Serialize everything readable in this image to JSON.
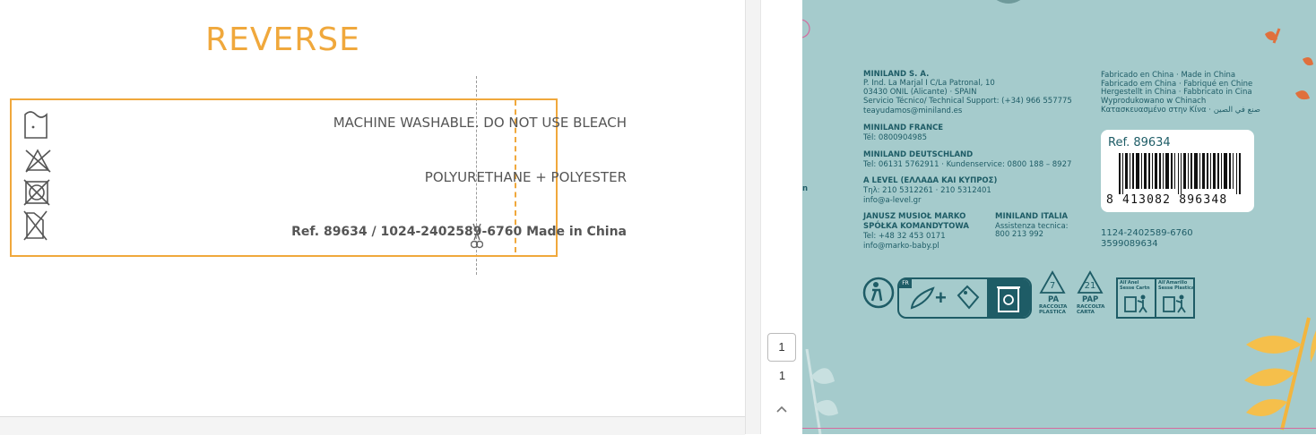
{
  "label": {
    "title": "REVERSE",
    "lines": [
      "MACHINE WASHABLE. DO NOT USE BLEACH",
      "POLYURETHANE + POLYESTER",
      "Ref. 89634 / 1024-2402589-6760 Made in China"
    ]
  },
  "sidebar": {
    "page_input": "1",
    "page_count": "1"
  },
  "packaging": {
    "left_letter": "n",
    "company": {
      "name": "MINILAND S. A.",
      "address_1": "P. Ind. La Marjal I C/La Patronal, 10",
      "address_2": "03430 ONIL (Alicante) · SPAIN",
      "support": "Servicio Técnico/ Technical Support: (+34) 966 557775",
      "email": "teayudamos@miniland.es"
    },
    "france": {
      "name": "MINILAND FRANCE",
      "phone": "Tél: 0800904985"
    },
    "germany": {
      "name": "MINILAND DEUTSCHLAND",
      "phone": "Tel: 06131 5762911 · Kundenservice: 0800 188 – 8927"
    },
    "greece": {
      "name": "A LEVEL (ΕΛΛΑΔΑ ΚΑΙ ΚΥΠΡΟΣ)",
      "phone": "Τηλ: 210 5312261 · 210 5312401",
      "email": "info@a-level.gr"
    },
    "poland": {
      "name_1": "JANUSZ MUSIOŁ MARKO",
      "name_2": "SPÓŁKA KOMANDYTOWA",
      "phone": "Tel: +48 32 453 0171",
      "email": "info@marko-baby.pl"
    },
    "italy": {
      "name": "MINILAND ITALIA",
      "line_1": "Assistenza tecnica:",
      "line_2": "800 213 992"
    },
    "made_in": [
      "Fabricado en China · Made in China",
      "Fabricado em China · Fabriqué en Chine",
      "Hergestellt in China · Fabbricato in Cina",
      "Wyprodukowano w Chinach",
      "Κατασκευασμένο στην Κίνα · صنع في الصين"
    ],
    "barcode": {
      "ref": "Ref. 89634",
      "number": "8 413082 896348"
    },
    "codes": [
      "1124-2402589-6760",
      "3599089634"
    ],
    "recycling": {
      "fr_tag": "FR",
      "pa_num": "7",
      "pa_label": "PA",
      "pa_sub_1": "RACCOLTA",
      "pa_sub_2": "PLASTICA",
      "pap_num": "21",
      "pap_label": "PAP",
      "pap_sub_1": "RACCOLTA",
      "pap_sub_2": "CARTA",
      "bin_1_line_1": "All'Anel",
      "bin_1_line_2": "Sesse Cartn",
      "bin_2_line_1": "All'Amarillo",
      "bin_2_line_2": "Sesse Plastica"
    }
  }
}
